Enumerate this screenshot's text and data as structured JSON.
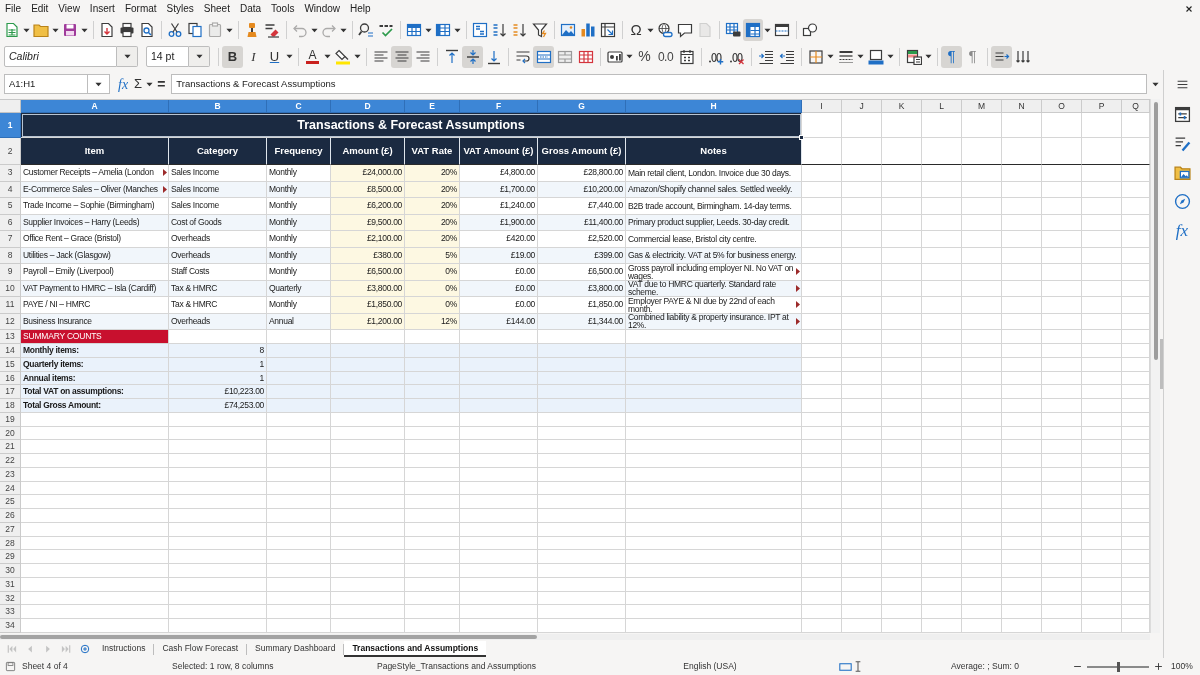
{
  "menu": [
    "File",
    "Edit",
    "View",
    "Insert",
    "Format",
    "Styles",
    "Sheet",
    "Data",
    "Tools",
    "Window",
    "Help"
  ],
  "standard_toolbar": [
    [
      {
        "kind": "new_spreadsheet",
        "dropdown": true,
        "on": false,
        "disabled": false
      },
      {
        "kind": "open",
        "dropdown": true,
        "on": false,
        "disabled": false
      },
      {
        "kind": "save",
        "dropdown": true,
        "on": false,
        "disabled": false
      }
    ],
    [
      {
        "kind": "export_pdf",
        "dropdown": false,
        "on": false,
        "disabled": false
      },
      {
        "kind": "print",
        "dropdown": false,
        "on": false,
        "disabled": false
      },
      {
        "kind": "print_preview",
        "dropdown": false,
        "on": false,
        "disabled": false
      }
    ],
    [
      {
        "kind": "cut",
        "dropdown": false,
        "on": false,
        "disabled": false
      },
      {
        "kind": "copy",
        "dropdown": false,
        "on": false,
        "disabled": false
      },
      {
        "kind": "paste",
        "dropdown": true,
        "on": false,
        "disabled": true
      }
    ],
    [
      {
        "kind": "clone_formatting",
        "dropdown": false,
        "on": false,
        "disabled": false
      },
      {
        "kind": "clear_formatting",
        "dropdown": false,
        "on": false,
        "disabled": false
      }
    ],
    [
      {
        "kind": "undo",
        "dropdown": true,
        "on": false,
        "disabled": true
      },
      {
        "kind": "redo",
        "dropdown": true,
        "on": false,
        "disabled": true
      }
    ],
    [
      {
        "kind": "find_replace",
        "dropdown": false,
        "on": false,
        "disabled": false
      },
      {
        "kind": "spelling",
        "dropdown": false,
        "on": false,
        "disabled": false
      }
    ],
    [
      {
        "kind": "rows",
        "dropdown": true,
        "on": false,
        "disabled": false
      },
      {
        "kind": "columns",
        "dropdown": true,
        "on": false,
        "disabled": false
      }
    ],
    [
      {
        "kind": "sort",
        "dropdown": false,
        "on": false,
        "disabled": false
      },
      {
        "kind": "sort_ascending",
        "dropdown": false,
        "on": false,
        "disabled": false
      },
      {
        "kind": "sort_descending",
        "dropdown": false,
        "on": false,
        "disabled": false
      },
      {
        "kind": "autofilter",
        "dropdown": false,
        "on": false,
        "disabled": false
      }
    ],
    [
      {
        "kind": "image",
        "dropdown": false,
        "on": false,
        "disabled": false
      },
      {
        "kind": "chart",
        "dropdown": false,
        "on": false,
        "disabled": false
      },
      {
        "kind": "pivot_table",
        "dropdown": false,
        "on": false,
        "disabled": false
      }
    ],
    [
      {
        "kind": "special_character",
        "label": "Ω",
        "dropdown": true,
        "on": false,
        "disabled": false
      },
      {
        "kind": "hyperlink",
        "dropdown": false,
        "on": false,
        "disabled": false
      },
      {
        "kind": "comment",
        "dropdown": false,
        "on": false,
        "disabled": false
      },
      {
        "kind": "header_footer",
        "dropdown": false,
        "on": false,
        "disabled": true
      }
    ],
    [
      {
        "kind": "print_area",
        "dropdown": false,
        "on": false,
        "disabled": false
      },
      {
        "kind": "freeze",
        "dropdown": true,
        "on": true,
        "disabled": false
      },
      {
        "kind": "split_window",
        "dropdown": false,
        "on": false,
        "disabled": false
      }
    ],
    [
      {
        "kind": "shapes",
        "dropdown": false,
        "on": false,
        "disabled": false
      }
    ]
  ],
  "formatting_toolbar": {
    "font_name": "Calibri",
    "font_size": "14 pt",
    "groups": [
      [
        {
          "kind": "bold",
          "label": "B",
          "dropdown": false,
          "on": true
        },
        {
          "kind": "italic",
          "label": "I",
          "dropdown": false,
          "on": false
        },
        {
          "kind": "underline",
          "label": "U",
          "dropdown": true,
          "on": false
        }
      ],
      [
        {
          "kind": "font_color",
          "label": "A",
          "dropdown": true,
          "on": false
        },
        {
          "kind": "highlight",
          "dropdown": true,
          "on": false
        }
      ],
      [
        {
          "kind": "align_left",
          "dropdown": false,
          "on": false
        },
        {
          "kind": "align_center",
          "dropdown": false,
          "on": true
        },
        {
          "kind": "align_right",
          "dropdown": false,
          "on": false
        }
      ],
      [
        {
          "kind": "align_top",
          "dropdown": false,
          "on": false
        },
        {
          "kind": "align_middle",
          "dropdown": false,
          "on": true
        },
        {
          "kind": "align_bottom",
          "dropdown": false,
          "on": false
        }
      ],
      [
        {
          "kind": "wrap_text",
          "dropdown": false,
          "on": false
        },
        {
          "kind": "merge_center",
          "dropdown": false,
          "on": true
        },
        {
          "kind": "merge_cells",
          "dropdown": false,
          "on": false
        },
        {
          "kind": "unmerge_cells",
          "dropdown": false,
          "on": false
        }
      ],
      [
        {
          "kind": "currency_format",
          "dropdown": true,
          "on": false
        },
        {
          "kind": "percent_format",
          "label": "%",
          "dropdown": false,
          "on": false
        },
        {
          "kind": "number_format",
          "label": "0.0",
          "dropdown": false,
          "on": false
        },
        {
          "kind": "date_format",
          "dropdown": false,
          "on": false
        }
      ],
      [
        {
          "kind": "add_decimal",
          "dropdown": false,
          "on": false
        },
        {
          "kind": "delete_decimal",
          "dropdown": false,
          "on": false
        }
      ],
      [
        {
          "kind": "increase_indent",
          "dropdown": false,
          "on": false
        },
        {
          "kind": "decrease_indent",
          "dropdown": false,
          "on": false
        }
      ],
      [
        {
          "kind": "borders",
          "dropdown": true,
          "on": false
        },
        {
          "kind": "border_style",
          "dropdown": true,
          "on": false
        },
        {
          "kind": "border_color",
          "dropdown": true,
          "on": false
        }
      ],
      [
        {
          "kind": "conditional",
          "dropdown": true,
          "on": false
        }
      ],
      [
        {
          "kind": "left_to_right",
          "label": "¶",
          "dropdown": false,
          "on": true
        },
        {
          "kind": "right_to_left",
          "label": "¶",
          "dropdown": false,
          "on": false
        }
      ],
      [
        {
          "kind": "text_left_to_right",
          "dropdown": false,
          "on": true
        },
        {
          "kind": "text_top_to_bottom",
          "dropdown": false,
          "on": false
        }
      ]
    ]
  },
  "formula_bar": {
    "name_box": "A1:H1",
    "buttons": [
      {
        "kind": "function_wizard",
        "label": "fx",
        "dropdown": false
      },
      {
        "kind": "sum",
        "label": "Σ",
        "dropdown": true
      },
      {
        "kind": "formula",
        "label": "=",
        "dropdown": false
      }
    ],
    "content": "Transactions & Forecast Assumptions"
  },
  "sheet": {
    "columns": [
      {
        "label": "A",
        "selected": true
      },
      {
        "label": "B",
        "selected": true
      },
      {
        "label": "C",
        "selected": true
      },
      {
        "label": "D",
        "selected": true
      },
      {
        "label": "E",
        "selected": true
      },
      {
        "label": "F",
        "selected": true
      },
      {
        "label": "G",
        "selected": true
      },
      {
        "label": "H",
        "selected": true
      },
      {
        "label": "I",
        "selected": false
      },
      {
        "label": "J",
        "selected": false
      },
      {
        "label": "K",
        "selected": false
      },
      {
        "label": "L",
        "selected": false
      },
      {
        "label": "M",
        "selected": false
      },
      {
        "label": "N",
        "selected": false
      },
      {
        "label": "O",
        "selected": false
      },
      {
        "label": "P",
        "selected": false
      },
      {
        "label": "Q",
        "selected": false
      }
    ],
    "row_numbers": [
      {
        "label": "1",
        "selected": true
      },
      {
        "label": "2",
        "selected": false
      },
      {
        "label": "3",
        "selected": false
      },
      {
        "label": "4",
        "selected": false
      },
      {
        "label": "5",
        "selected": false
      },
      {
        "label": "6",
        "selected": false
      },
      {
        "label": "7",
        "selected": false
      },
      {
        "label": "8",
        "selected": false
      },
      {
        "label": "9",
        "selected": false
      },
      {
        "label": "10",
        "selected": false
      },
      {
        "label": "11",
        "selected": false
      },
      {
        "label": "12",
        "selected": false
      },
      {
        "label": "13",
        "selected": false
      },
      {
        "label": "14",
        "selected": false
      },
      {
        "label": "15",
        "selected": false
      },
      {
        "label": "16",
        "selected": false
      },
      {
        "label": "17",
        "selected": false
      },
      {
        "label": "18",
        "selected": false
      },
      {
        "label": "19",
        "selected": false
      },
      {
        "label": "20",
        "selected": false
      },
      {
        "label": "21",
        "selected": false
      },
      {
        "label": "22",
        "selected": false
      },
      {
        "label": "23",
        "selected": false
      },
      {
        "label": "24",
        "selected": false
      },
      {
        "label": "25",
        "selected": false
      },
      {
        "label": "26",
        "selected": false
      },
      {
        "label": "27",
        "selected": false
      },
      {
        "label": "28",
        "selected": false
      },
      {
        "label": "29",
        "selected": false
      },
      {
        "label": "30",
        "selected": false
      },
      {
        "label": "31",
        "selected": false
      },
      {
        "label": "32",
        "selected": false
      },
      {
        "label": "33",
        "selected": false
      },
      {
        "label": "34",
        "selected": false
      }
    ],
    "title": {
      "text": "Transactions & Forecast Assumptions",
      "selected": true
    },
    "header": [
      "Item",
      "Category",
      "Frequency",
      "Amount (£)",
      "VAT Rate",
      "VAT Amount (£)",
      "Gross Amount (£)",
      "Notes"
    ],
    "rows": [
      {
        "item": "Customer Receipts – Amelia (London",
        "item_clipped": true,
        "category": "Sales Income",
        "frequency": "Monthly",
        "amount": "£24,000.00",
        "vat_rate": "20%",
        "vat_amount": "£4,800.00",
        "gross_amount": "£28,800.00",
        "notes": "Main retail client, London. Invoice due 30 days.",
        "notes_clipped": false
      },
      {
        "item": "E-Commerce Sales – Oliver (Manches",
        "item_clipped": true,
        "category": "Sales Income",
        "frequency": "Monthly",
        "amount": "£8,500.00",
        "vat_rate": "20%",
        "vat_amount": "£1,700.00",
        "gross_amount": "£10,200.00",
        "notes": "Amazon/Shopify channel sales. Settled weekly.",
        "notes_clipped": false
      },
      {
        "item": "Trade Income – Sophie (Birmingham)",
        "item_clipped": false,
        "category": "Sales Income",
        "frequency": "Monthly",
        "amount": "£6,200.00",
        "vat_rate": "20%",
        "vat_amount": "£1,240.00",
        "gross_amount": "£7,440.00",
        "notes": "B2B trade account, Birmingham. 14-day terms.",
        "notes_clipped": false
      },
      {
        "item": "Supplier Invoices – Harry (Leeds)",
        "item_clipped": false,
        "category": "Cost of Goods",
        "frequency": "Monthly",
        "amount": "£9,500.00",
        "vat_rate": "20%",
        "vat_amount": "£1,900.00",
        "gross_amount": "£11,400.00",
        "notes": "Primary product supplier, Leeds. 30-day credit.",
        "notes_clipped": false
      },
      {
        "item": "Office Rent – Grace (Bristol)",
        "item_clipped": false,
        "category": "Overheads",
        "frequency": "Monthly",
        "amount": "£2,100.00",
        "vat_rate": "20%",
        "vat_amount": "£420.00",
        "gross_amount": "£2,520.00",
        "notes": "Commercial lease, Bristol city centre.",
        "notes_clipped": false
      },
      {
        "item": "Utilities – Jack (Glasgow)",
        "item_clipped": false,
        "category": "Overheads",
        "frequency": "Monthly",
        "amount": "£380.00",
        "vat_rate": "5%",
        "vat_amount": "£19.00",
        "gross_amount": "£399.00",
        "notes": "Gas & electricity. VAT at 5% for business energy.",
        "notes_clipped": false
      },
      {
        "item": "Payroll – Emily (Liverpool)",
        "item_clipped": false,
        "category": "Staff Costs",
        "frequency": "Monthly",
        "amount": "£6,500.00",
        "vat_rate": "0%",
        "vat_amount": "£0.00",
        "gross_amount": "£6,500.00",
        "notes": "Gross payroll including employer NI. No VAT on wages.",
        "notes_clipped": true
      },
      {
        "item": "VAT Payment to HMRC – Isla (Cardiff)",
        "item_clipped": false,
        "category": "Tax & HMRC",
        "frequency": "Quarterly",
        "amount": "£3,800.00",
        "vat_rate": "0%",
        "vat_amount": "£0.00",
        "gross_amount": "£3,800.00",
        "notes": "VAT due to HMRC quarterly. Standard rate scheme.",
        "notes_clipped": true
      },
      {
        "item": "PAYE / NI – HMRC",
        "item_clipped": false,
        "category": "Tax & HMRC",
        "frequency": "Monthly",
        "amount": "£1,850.00",
        "vat_rate": "0%",
        "vat_amount": "£0.00",
        "gross_amount": "£1,850.00",
        "notes": "Employer PAYE & NI due by 22nd of each month.",
        "notes_clipped": true
      },
      {
        "item": "Business Insurance",
        "item_clipped": false,
        "category": "Overheads",
        "frequency": "Annual",
        "amount": "£1,200.00",
        "vat_rate": "12%",
        "vat_amount": "£144.00",
        "gross_amount": "£1,344.00",
        "notes": "Combined liability & property insurance. IPT at 12%.",
        "notes_clipped": true
      }
    ],
    "summary": {
      "heading": "SUMMARY COUNTS",
      "rows": [
        {
          "label": "Monthly items:",
          "value": "8"
        },
        {
          "label": "Quarterly items:",
          "value": "1"
        },
        {
          "label": "Annual items:",
          "value": "1"
        },
        {
          "label": "Total VAT on assumptions:",
          "value": "£10,223.00"
        },
        {
          "label": "Total Gross Amount:",
          "value": "£74,253.00"
        }
      ]
    }
  },
  "sheet_tabs": [
    {
      "label": "Instructions",
      "selected": false
    },
    {
      "label": "Cash Flow Forecast",
      "selected": false
    },
    {
      "label": "Summary Dashboard",
      "selected": false
    },
    {
      "label": "Transactions and Assumptions",
      "selected": true
    }
  ],
  "sidebar": [
    {
      "kind": "properties"
    },
    {
      "kind": "styles"
    },
    {
      "kind": "gallery"
    },
    {
      "kind": "navigator"
    },
    {
      "kind": "functions",
      "label": "fx"
    }
  ],
  "status_bar": {
    "sheet_position": "Sheet 4 of 4",
    "selection": "Selected: 1 row, 8 columns",
    "page_style": "PageStyle_Transactions and Assumptions",
    "language": "English (USA)",
    "statistics": "Average: ; Sum: 0",
    "zoom": {
      "level": 0.5,
      "percent": "100%"
    }
  }
}
